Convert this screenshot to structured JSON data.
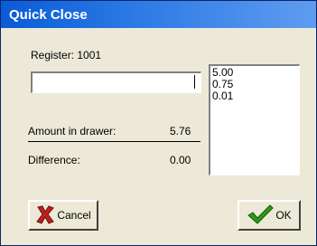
{
  "window": {
    "title": "Quick Close"
  },
  "register": {
    "label": "Register: 1001"
  },
  "amount_input": {
    "value": ""
  },
  "entries": [
    "5.00",
    "0.75",
    "0.01"
  ],
  "summary": {
    "amount_in_drawer_label": "Amount in drawer:",
    "amount_in_drawer_value": "5.76",
    "difference_label": "Difference:",
    "difference_value": "0.00"
  },
  "buttons": {
    "cancel_label": "Cancel",
    "cancel_icon": "red-x-icon",
    "ok_label": "OK",
    "ok_icon": "green-checkmark-icon"
  },
  "colors": {
    "titlebar": "#0a5bd7",
    "window_bg": "#ece9d8",
    "cancel_icon": "#c0201c",
    "ok_icon": "#2f9a18"
  }
}
